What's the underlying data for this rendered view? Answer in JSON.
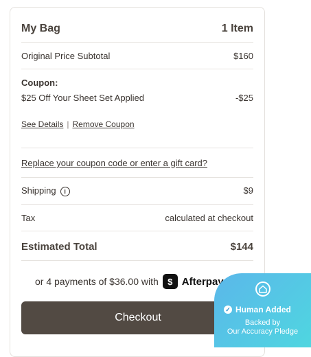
{
  "bag": {
    "title": "My Bag",
    "count": "1 Item"
  },
  "subtotal": {
    "label": "Original Price Subtotal",
    "value": "$160"
  },
  "coupon": {
    "heading": "Coupon:",
    "description": "$25 Off Your Sheet Set Applied",
    "value": "-$25",
    "see_details": "See Details",
    "separator": "|",
    "remove": "Remove Coupon",
    "replace_link": "Replace your coupon code or enter a gift card?"
  },
  "shipping": {
    "label": "Shipping",
    "info_icon": "info-icon",
    "value": "$9"
  },
  "tax": {
    "label": "Tax",
    "value": "calculated at checkout"
  },
  "total": {
    "label": "Estimated Total",
    "value": "$144"
  },
  "afterpay": {
    "text": "or 4 payments of $36.00 with",
    "brand": "Afterpay",
    "logo_icon": "afterpay-logo-icon"
  },
  "checkout": {
    "label": "Checkout"
  },
  "badge": {
    "title": "Human Added",
    "line1": "Backed by",
    "line2": "Our Accuracy Pledge",
    "icon": "house-icon"
  },
  "colors": {
    "checkout_bg": "#524a43",
    "badge_from": "#5bb7ea",
    "badge_to": "#4fd6e0"
  }
}
